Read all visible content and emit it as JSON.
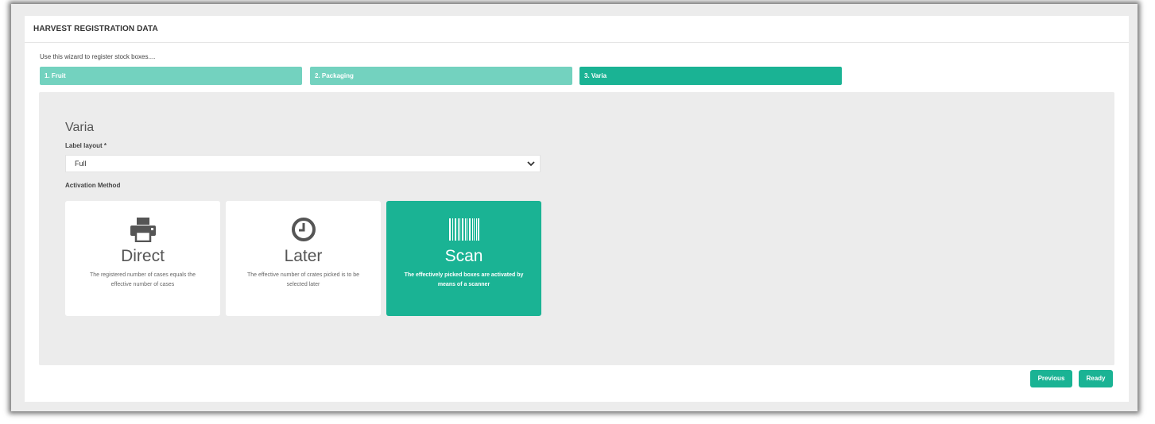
{
  "panel": {
    "title": "HARVEST REGISTRATION DATA"
  },
  "wizard": {
    "intro": "Use this wizard to register stock boxes....",
    "steps": [
      {
        "label": "1. Fruit"
      },
      {
        "label": "2. Packaging"
      },
      {
        "label": "3. Varia"
      }
    ],
    "active_step": 3
  },
  "varia": {
    "title": "Varia",
    "label_layout": {
      "label": "Label layout *",
      "value": "Full"
    },
    "activation": {
      "label": "Activation Method",
      "options": [
        {
          "name": "Direct",
          "icon": "printer-icon",
          "description": "The registered number of cases equals the effective number of cases"
        },
        {
          "name": "Later",
          "icon": "clock-icon",
          "description": "The effective number of crates picked is to be selected later"
        },
        {
          "name": "Scan",
          "icon": "barcode-icon",
          "description": "The effectively picked boxes are activated by means of a scanner"
        }
      ],
      "selected": "Scan"
    }
  },
  "buttons": {
    "previous": "Previous",
    "ready": "Ready"
  },
  "colors": {
    "accent": "#1ab394",
    "step_inactive": "#73d2bf",
    "content_bg": "#ececec"
  }
}
